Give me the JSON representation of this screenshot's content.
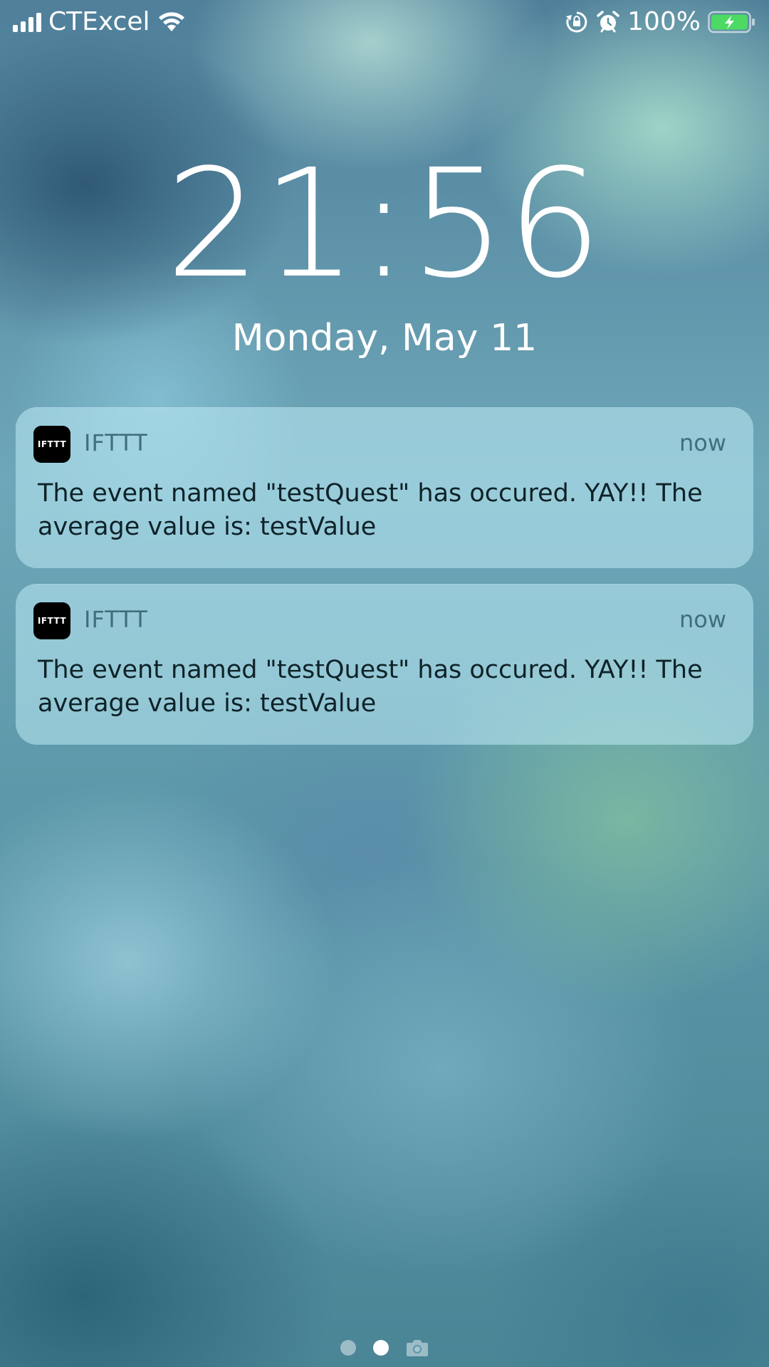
{
  "status_bar": {
    "carrier": "CTExcel",
    "battery_percent": "100%",
    "signal_bars": 4,
    "icons": [
      "signal-icon",
      "wifi-icon",
      "rotation-lock-icon",
      "alarm-icon",
      "battery-charging-icon"
    ],
    "battery_color": "#4cd964"
  },
  "lock_screen": {
    "time": "21:56",
    "date": "Monday, May 11"
  },
  "notifications": [
    {
      "app_icon_text": "IFTTT",
      "app_name": "IFTTT",
      "time": "now",
      "body": "The event named \"testQuest\" has occured. YAY!! The average value is: testValue"
    },
    {
      "app_icon_text": "IFTTT",
      "app_name": "IFTTT",
      "time": "now",
      "body": "The event named \"testQuest\" has occured. YAY!! The average value is: testValue"
    }
  ],
  "page_indicator": {
    "pages": 2,
    "active_index": 1,
    "trailing_icon": "camera-icon"
  }
}
